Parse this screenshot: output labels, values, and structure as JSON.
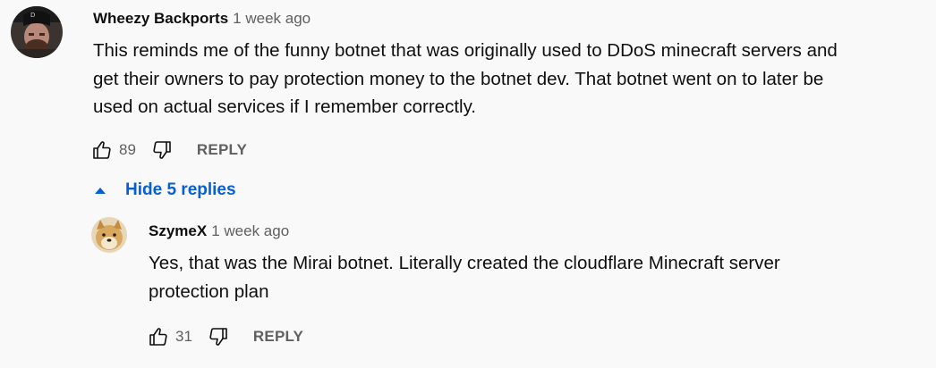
{
  "comments": [
    {
      "author": "Wheezy Backports",
      "time": "1 week ago",
      "text_lines": [
        "This reminds me of the funny botnet that was originally used to DDoS minecraft servers and",
        "get their owners to pay protection money to the botnet dev. That botnet went on to later be",
        "used on actual services if I remember correctly."
      ],
      "likes": "89",
      "reply_label": "REPLY",
      "like_icon": "thumb-up-icon",
      "dislike_icon": "thumb-down-icon"
    }
  ],
  "replies_toggle": {
    "label": "Hide 5 replies",
    "icon": "caret-up-icon",
    "color": "#065fd4"
  },
  "replies": [
    {
      "author": "SzymeX",
      "time": "1 week ago",
      "text_lines": [
        "Yes, that was the Mirai botnet. Literally created the cloudflare Minecraft server",
        "protection plan"
      ],
      "likes": "31",
      "reply_label": "REPLY",
      "like_icon": "thumb-up-icon",
      "dislike_icon": "thumb-down-icon"
    }
  ],
  "colors": {
    "background": "#f9f9f9",
    "primary_text": "#0f0f0f",
    "secondary_text": "#606060",
    "link_blue": "#065fd4"
  }
}
